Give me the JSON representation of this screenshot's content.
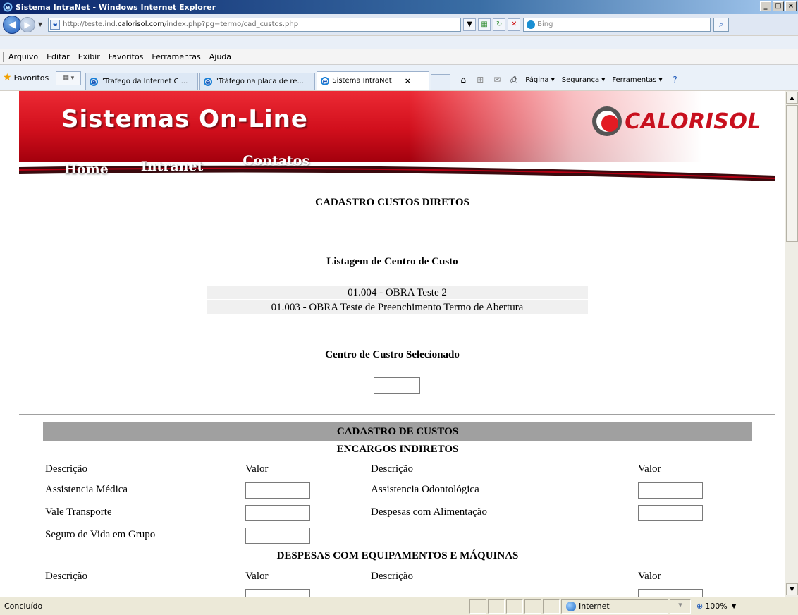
{
  "window": {
    "title": "Sistema IntraNet - Windows Internet Explorer",
    "buttons": {
      "minimize": "_",
      "maximize": "□",
      "close": "×"
    }
  },
  "addressbar": {
    "url_prefix": "http://teste.ind.",
    "url_domain": "calorisol.com",
    "url_path": "/index.php?pg=termo/cad_custos.php",
    "search_placeholder": "Bing"
  },
  "menu": [
    "Arquivo",
    "Editar",
    "Exibir",
    "Favoritos",
    "Ferramentas",
    "Ajuda"
  ],
  "favbar": {
    "favorites_label": "Favoritos",
    "tabs": [
      {
        "label": "\"Trafego da Internet C ..."
      },
      {
        "label": "\"Tráfego na placa de re..."
      },
      {
        "label": "Sistema IntraNet",
        "close": "×"
      }
    ],
    "commands": {
      "page": "Página ▾",
      "security": "Segurança ▾",
      "tools": "Ferramentas ▾"
    }
  },
  "banner": {
    "brand": "Sistemas On-Line",
    "nav": [
      "Home",
      "Intranet",
      "Contatos"
    ],
    "logo_text": "CALORISOL"
  },
  "page": {
    "title": "CADASTRO CUSTOS DIRETOS",
    "list_heading": "Listagem de Centro de Custo",
    "cost_centers": [
      "01.004 - OBRA Teste 2",
      "01.003 - OBRA Teste de Preenchimento Termo de Abertura"
    ],
    "selected_heading": "Centro de Custro Selecionado",
    "section_title": "CADASTRO DE CUSTOS",
    "encargos": {
      "title": "ENCARGOS INDIRETOS",
      "col_desc": "Descrição",
      "col_valor": "Valor",
      "left": [
        "Assistencia Médica",
        "Vale Transporte",
        "Seguro de Vida em Grupo"
      ],
      "right": [
        "Assistencia Odontológica",
        "Despesas com Alimentação"
      ]
    },
    "equipamentos": {
      "title": "DESPESAS COM EQUIPAMENTOS E MÁQUINAS",
      "col_desc": "Descrição",
      "col_valor": "Valor"
    }
  },
  "statusbar": {
    "status": "Concluído",
    "zone": "Internet",
    "zoom": "100%"
  }
}
